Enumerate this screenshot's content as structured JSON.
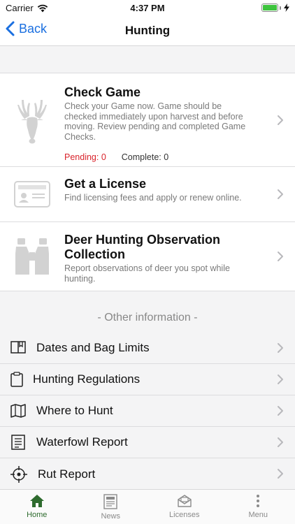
{
  "status_bar": {
    "carrier": "Carrier",
    "time": "4:37 PM"
  },
  "nav": {
    "back_label": "Back",
    "title": "Hunting"
  },
  "features": [
    {
      "title": "Check Game",
      "description": "Check your Game now. Game should be checked immediately upon harvest and before moving. Review pending and completed Game Checks.",
      "icon": "deer-icon",
      "pending": "Pending: 0",
      "complete": "Complete: 0"
    },
    {
      "title": "Get a License",
      "description": "Find licensing fees and apply or renew online.",
      "icon": "license-card-icon"
    },
    {
      "title": "Deer Hunting Observation Collection",
      "description": "Report observations of deer you spot while hunting.",
      "icon": "binoculars-icon"
    }
  ],
  "other_header": "- Other information -",
  "links": [
    {
      "label": "Dates and Bag Limits",
      "icon": "book-icon"
    },
    {
      "label": "Hunting Regulations",
      "icon": "clipboard-icon"
    },
    {
      "label": "Where to Hunt",
      "icon": "map-icon"
    },
    {
      "label": "Waterfowl Report",
      "icon": "report-icon"
    },
    {
      "label": "Rut Report",
      "icon": "crosshair-icon"
    }
  ],
  "tabs": [
    {
      "label": "Home",
      "icon": "home-icon",
      "active": true
    },
    {
      "label": "News",
      "icon": "news-icon",
      "active": false
    },
    {
      "label": "Licenses",
      "icon": "licenses-icon",
      "active": false
    },
    {
      "label": "Menu",
      "icon": "more-dots-icon",
      "active": false
    }
  ],
  "colors": {
    "accent_blue": "#1a6fe0",
    "pending_red": "#d9242c",
    "active_tab_green": "#2e6b2e",
    "battery_green": "#3ec43e"
  }
}
